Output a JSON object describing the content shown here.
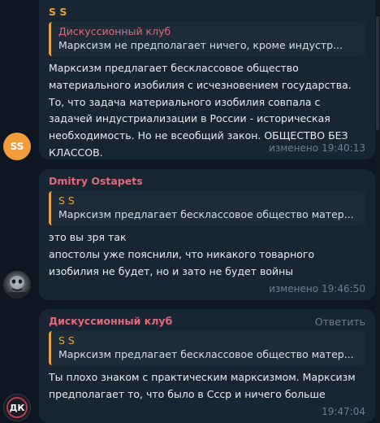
{
  "messages": [
    {
      "sender": "S S",
      "sender_color": "#e5a33b",
      "avatar_initials": "SS",
      "avatar_color": "#f5a33b",
      "quote": {
        "name": "Дискуссионный клуб",
        "name_color": "#e5a33b",
        "text": "Марксизм не предполагает ничего, кроме индустр..."
      },
      "lines": [
        "Марксизм предлагает бесклассовое общество",
        "материального изобилия с исчезновением государства.",
        "То, что задача материального изобилия совпала с",
        "задачей индустриализации в России - историческая",
        "необходимость. Но не всеобщий закон. ОБЩЕСТВО БЕЗ",
        "КЛАССОВ."
      ],
      "edited": "изменено",
      "time": "19:40:13"
    },
    {
      "sender": "Dmitry Ostapets",
      "sender_color": "#e0697c",
      "quote": {
        "name": "S S",
        "name_color": "#e5a33b",
        "text": "Марксизм предлагает бесклассовое общество матер..."
      },
      "lines": [
        "это вы зря так",
        "апостолы уже пояснили, что никакого товарного",
        "изобилия не будет, но и зато не будет войны"
      ],
      "edited": "изменено",
      "time": "19:46:50"
    },
    {
      "sender": "Дискуссионный клуб",
      "sender_color": "#e0697c",
      "reply_label": "Ответить",
      "avatar_initials": "ДК",
      "avatar_color": "#1c1c24",
      "quote": {
        "name": "S S",
        "name_color": "#e5a33b",
        "text": "Марксизм предлагает бесклассовое общество матер..."
      },
      "lines": [
        "Ты плохо знаком с практическим марксизмом. Марксизм",
        "предполагает то, что было в Ссср и ничего больше"
      ],
      "time": "19:47:04"
    }
  ]
}
